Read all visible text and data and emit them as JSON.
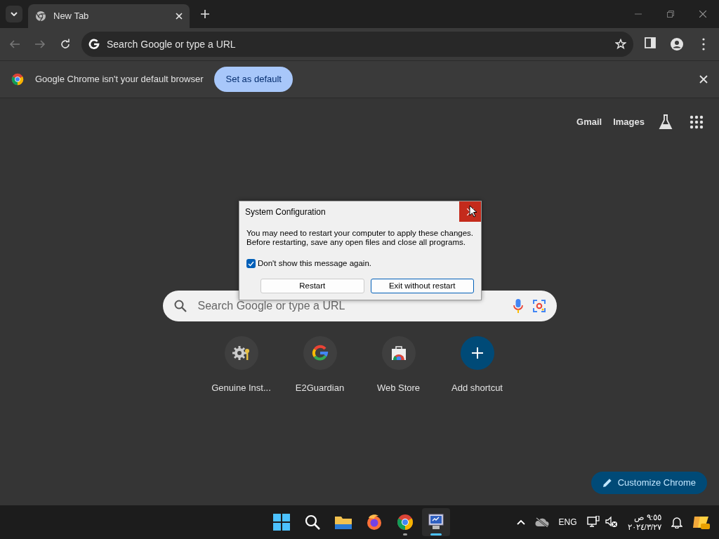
{
  "tabs": [
    {
      "title": "New Tab",
      "selected": true
    }
  ],
  "omnibox": {
    "placeholder": "Search Google or type a URL"
  },
  "infobar": {
    "message": "Google Chrome isn't your default browser",
    "button": "Set as default"
  },
  "ntp": {
    "links": [
      "Gmail",
      "Images"
    ],
    "search_placeholder": "Search Google or type a URL",
    "shortcuts": [
      {
        "label": "Genuine Inst...",
        "kind": "gear"
      },
      {
        "label": "E2Guardian",
        "kind": "google"
      },
      {
        "label": "Web Store",
        "kind": "store"
      },
      {
        "label": "Add shortcut",
        "kind": "add"
      }
    ],
    "customize": "Customize Chrome"
  },
  "dialog": {
    "title": "System Configuration",
    "message": [
      "You may need to restart your computer to apply these changes.",
      "Before restarting, save any open files and close all programs."
    ],
    "checkbox": {
      "label": "Don't show this message again.",
      "checked": true
    },
    "buttons": [
      {
        "label": "Restart",
        "default": false
      },
      {
        "label": "Exit without restart",
        "default": true
      }
    ],
    "close_hovered": true
  },
  "taskbar": {
    "apps": [
      {
        "kind": "start",
        "running": false,
        "active": false
      },
      {
        "kind": "search",
        "running": false,
        "active": false
      },
      {
        "kind": "folder",
        "running": false,
        "active": false
      },
      {
        "kind": "firefox",
        "running": false,
        "active": false
      },
      {
        "kind": "chrome",
        "running": true,
        "active": false
      },
      {
        "kind": "monitor",
        "running": true,
        "active": true
      }
    ],
    "language": "ENG",
    "time": "٩:٥٥ ص",
    "date": "٢٠٢٤/٣/٢٧"
  }
}
